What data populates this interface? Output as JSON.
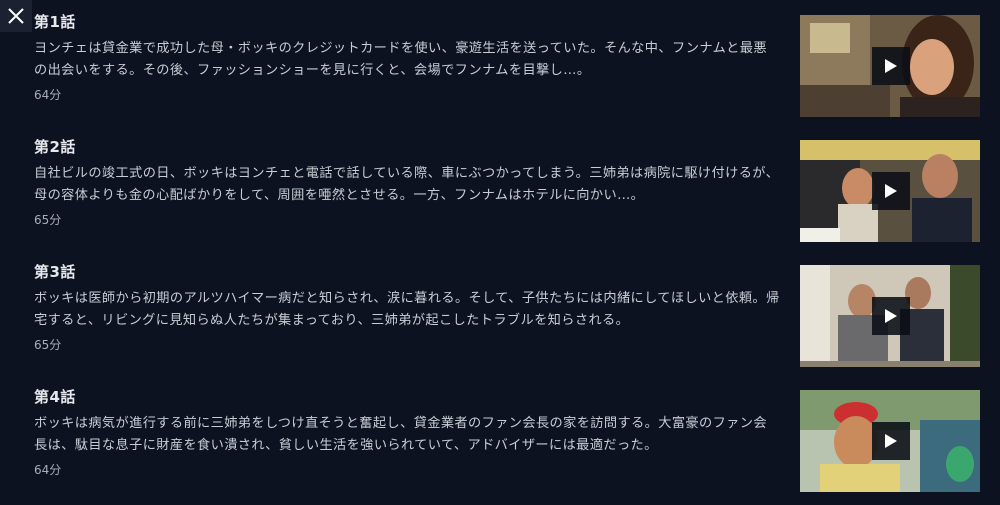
{
  "icons": {
    "close": "close-icon",
    "play": "play-icon"
  },
  "episodes": [
    {
      "title": "第1話",
      "description": "ヨンチェは貸金業で成功した母・ボッキのクレジットカードを使い、豪遊生活を送っていた。そんな中、フンナムと最悪の出会いをする。その後、ファッションショーを見に行くと、会場でフンナムを目撃し…。",
      "duration": "64分"
    },
    {
      "title": "第2話",
      "description": "自社ビルの竣工式の日、ボッキはヨンチェと電話で話している際、車にぶつかってしまう。三姉弟は病院に駆け付けるが、母の容体よりも金の心配ばかりをして、周囲を唖然とさせる。一方、フンナムはホテルに向かい…。",
      "duration": "65分"
    },
    {
      "title": "第3話",
      "description": "ボッキは医師から初期のアルツハイマー病だと知らされ、涙に暮れる。そして、子供たちには内緒にしてほしいと依頼。帰宅すると、リビングに見知らぬ人たちが集まっており、三姉弟が起こしたトラブルを知らされる。",
      "duration": "65分"
    },
    {
      "title": "第4話",
      "description": "ボッキは病気が進行する前に三姉弟をしつけ直そうと奮起し、貸金業者のファン会長の家を訪問する。大富豪のファン会長は、駄目な息子に財産を食い潰され、貧しい生活を強いられていて、アドバイザーには最適だった。",
      "duration": "64分"
    }
  ]
}
